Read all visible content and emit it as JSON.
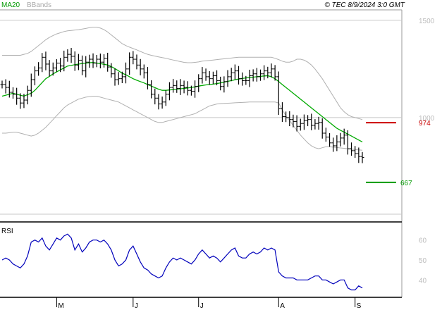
{
  "chart_data": [
    {
      "type": "ohlc",
      "legend": [
        "MA20",
        "BBands"
      ],
      "header_right": "© TEC 8/9/2024 3:0 GMT",
      "y_ticks": [
        {
          "value": 1500,
          "label": "1500"
        },
        {
          "value": 1000,
          "label": "1000"
        }
      ],
      "ylim": [
        500,
        1550
      ],
      "levels": [
        {
          "value": 974,
          "label": "974",
          "color": "#cc0000"
        },
        {
          "value": 667,
          "label": "667",
          "color": "#009900"
        }
      ],
      "x_ticks": [
        {
          "index": 15,
          "label": "M"
        },
        {
          "index": 36,
          "label": "J"
        },
        {
          "index": 54,
          "label": "J"
        },
        {
          "index": 76,
          "label": "A"
        },
        {
          "index": 97,
          "label": "S"
        }
      ],
      "closes": [
        1170,
        1155,
        1130,
        1120,
        1100,
        1075,
        1090,
        1140,
        1195,
        1240,
        1255,
        1310,
        1275,
        1240,
        1255,
        1280,
        1265,
        1310,
        1325,
        1315,
        1270,
        1295,
        1240,
        1285,
        1300,
        1280,
        1300,
        1285,
        1305,
        1260,
        1225,
        1195,
        1200,
        1210,
        1250,
        1310,
        1300,
        1270,
        1250,
        1230,
        1170,
        1120,
        1100,
        1070,
        1080,
        1120,
        1155,
        1165,
        1150,
        1165,
        1155,
        1140,
        1135,
        1160,
        1200,
        1230,
        1210,
        1200,
        1215,
        1190,
        1160,
        1185,
        1210,
        1230,
        1240,
        1200,
        1190,
        1190,
        1215,
        1225,
        1210,
        1225,
        1240,
        1230,
        1250,
        1210,
        1045,
        1005,
        1000,
        990,
        980,
        955,
        970,
        985,
        990,
        960,
        970,
        975,
        920,
        900,
        870,
        855,
        875,
        895,
        910,
        840,
        830,
        815,
        800,
        795
      ],
      "ma20": [
        1110,
        1115,
        1120,
        1125,
        1120,
        1115,
        1110,
        1118,
        1125,
        1140,
        1160,
        1180,
        1200,
        1212,
        1225,
        1235,
        1245,
        1255,
        1265,
        1268,
        1272,
        1275,
        1278,
        1280,
        1282,
        1283,
        1280,
        1277,
        1274,
        1270,
        1262,
        1252,
        1240,
        1228,
        1220,
        1210,
        1200,
        1192,
        1185,
        1178,
        1170,
        1162,
        1154,
        1146,
        1140,
        1140,
        1142,
        1144,
        1146,
        1148,
        1150,
        1152,
        1155,
        1158,
        1162,
        1165,
        1168,
        1170,
        1172,
        1175,
        1178,
        1182,
        1186,
        1190,
        1194,
        1198,
        1201,
        1204,
        1206,
        1208,
        1210,
        1212,
        1214,
        1215,
        1210,
        1200,
        1185,
        1170,
        1155,
        1140,
        1125,
        1110,
        1095,
        1080,
        1065,
        1050,
        1035,
        1020,
        1005,
        990,
        975,
        960,
        945,
        935,
        925,
        915,
        905,
        895,
        885,
        875
      ],
      "bb_upper": [
        1320,
        1320,
        1320,
        1320,
        1320,
        1320,
        1325,
        1330,
        1340,
        1355,
        1370,
        1385,
        1400,
        1412,
        1422,
        1430,
        1436,
        1442,
        1446,
        1448,
        1450,
        1452,
        1455,
        1458,
        1462,
        1465,
        1465,
        1460,
        1452,
        1440,
        1425,
        1410,
        1395,
        1380,
        1370,
        1362,
        1355,
        1348,
        1340,
        1332,
        1325,
        1320,
        1316,
        1312,
        1308,
        1305,
        1300,
        1296,
        1292,
        1288,
        1284,
        1282,
        1282,
        1284,
        1286,
        1290,
        1292,
        1294,
        1296,
        1298,
        1300,
        1302,
        1304,
        1306,
        1308,
        1310,
        1310,
        1310,
        1310,
        1310,
        1310,
        1310,
        1310,
        1310,
        1310,
        1305,
        1298,
        1290,
        1285,
        1285,
        1290,
        1300,
        1300,
        1295,
        1285,
        1270,
        1250,
        1225,
        1200,
        1170,
        1140,
        1110,
        1080,
        1050,
        1030,
        1015,
        1005,
        1000,
        995,
        990
      ],
      "bb_lower": [
        920,
        920,
        922,
        925,
        925,
        920,
        915,
        910,
        905,
        910,
        920,
        935,
        950,
        970,
        990,
        1010,
        1030,
        1050,
        1065,
        1075,
        1085,
        1095,
        1100,
        1105,
        1108,
        1110,
        1110,
        1105,
        1100,
        1095,
        1090,
        1085,
        1080,
        1070,
        1060,
        1050,
        1040,
        1030,
        1020,
        1010,
        1000,
        990,
        980,
        975,
        975,
        980,
        985,
        990,
        995,
        1000,
        1005,
        1010,
        1015,
        1020,
        1030,
        1040,
        1050,
        1060,
        1065,
        1070,
        1072,
        1073,
        1074,
        1075,
        1076,
        1077,
        1078,
        1079,
        1080,
        1080,
        1080,
        1080,
        1080,
        1080,
        1080,
        1080,
        1075,
        1040,
        1010,
        985,
        960,
        935,
        910,
        890,
        870,
        855,
        845,
        840,
        845,
        850,
        850,
        848,
        846,
        844,
        842,
        840,
        838,
        836,
        834,
        832
      ]
    },
    {
      "type": "line",
      "label": "RSI",
      "y_ticks": [
        {
          "value": 60,
          "label": "60"
        },
        {
          "value": 50,
          "label": "50"
        },
        {
          "value": 40,
          "label": "40"
        }
      ],
      "ylim": [
        32,
        68
      ],
      "values": [
        50,
        51,
        50,
        48,
        47,
        46,
        48,
        52,
        59,
        60,
        59,
        61,
        57,
        55,
        58,
        61,
        60,
        62,
        63,
        61,
        55,
        58,
        54,
        56,
        59,
        60,
        60,
        59,
        60,
        58,
        55,
        50,
        47,
        48,
        50,
        55,
        57,
        53,
        49,
        46,
        45,
        43,
        42,
        41,
        42,
        46,
        49,
        51,
        50,
        51,
        50,
        49,
        48,
        50,
        53,
        55,
        53,
        51,
        52,
        51,
        49,
        51,
        53,
        55,
        56,
        52,
        51,
        51,
        53,
        54,
        53,
        54,
        56,
        55,
        56,
        55,
        44,
        42,
        41,
        41,
        41,
        40,
        40,
        40,
        40,
        41,
        42,
        42,
        40,
        40,
        39,
        38,
        39,
        40,
        40,
        36,
        35,
        35,
        37,
        36
      ]
    }
  ]
}
